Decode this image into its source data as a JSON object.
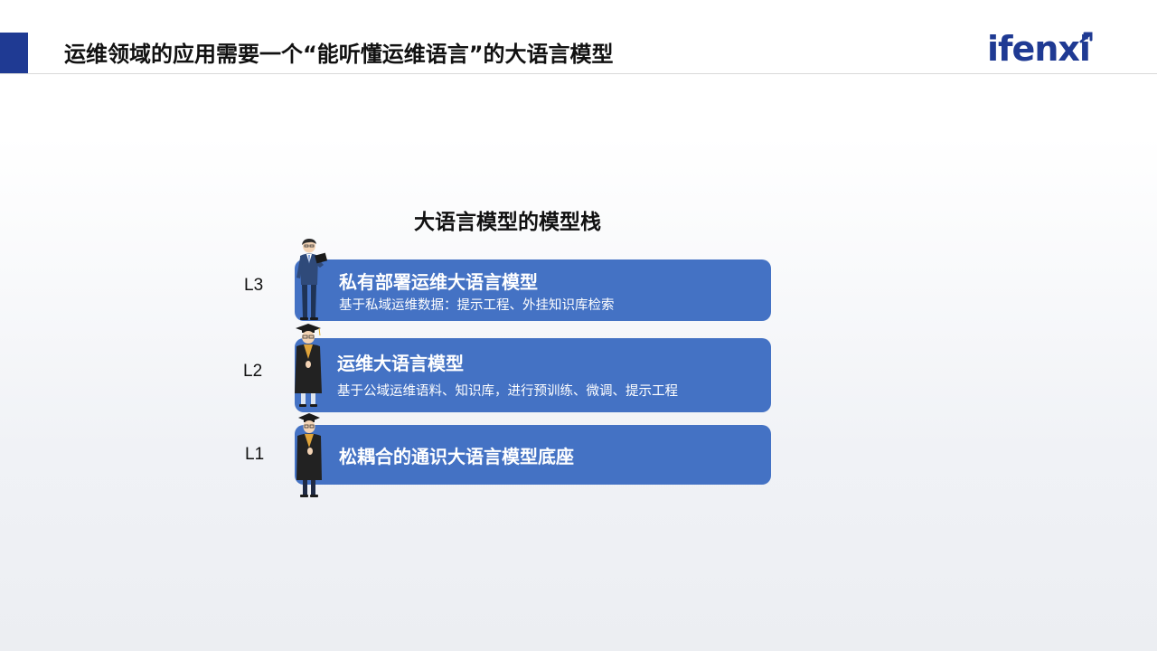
{
  "header": {
    "title": "运维领域的应用需要一个“能听懂运维语言”的大语言模型",
    "logo_text": "ifenxi",
    "accent_color": "#1f3a93"
  },
  "stack": {
    "title": "大语言模型的模型栈",
    "card_color": "#4472c4",
    "levels": [
      {
        "label": "L3",
        "title": "私有部署运维大语言模型",
        "subtitle": "基于私域运维数据：提示工程、外挂知识库检索",
        "figure": "business-person-icon"
      },
      {
        "label": "L2",
        "title": "运维大语言模型",
        "subtitle": "基于公域运维语料、知识库，进行预训练、微调、提示工程",
        "figure": "graduate-icon"
      },
      {
        "label": "L1",
        "title": "松耦合的通识大语言模型底座",
        "figure": "student-icon"
      }
    ]
  }
}
